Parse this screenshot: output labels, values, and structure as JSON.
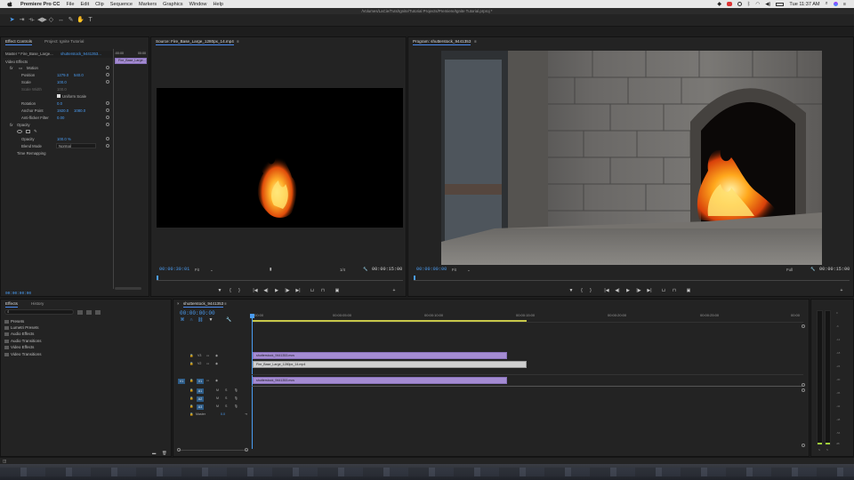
{
  "menubar": {
    "app_name": "Premiere Pro CC",
    "items": [
      "File",
      "Edit",
      "Clip",
      "Sequence",
      "Markers",
      "Graphics",
      "Window",
      "Help"
    ],
    "clock": "Tue 11:37 AM"
  },
  "title_path": "/Volumes/LaCie/Tuts/Ignite/Tutorial Projects/Premiere/Ignite Tutorial.prproj *",
  "effect_controls": {
    "tabs": [
      "Effect Controls",
      "Project: Ignite Tutorial"
    ],
    "master_label": "Master * Fire_Base_Large...",
    "clip_label": "shutterstock_9441353...",
    "mini_timeline_clip": "Fire_Base_Large...",
    "mini_ruler_start": ":00:00",
    "mini_ruler_end": "00:00",
    "section_video_effects": "Video Effects",
    "motion": "Motion",
    "position_label": "Position",
    "position_x": "1279.0",
    "position_y": "540.0",
    "scale_label": "Scale",
    "scale_value": "100.0",
    "scale_width_label": "Scale Width",
    "scale_width_value": "100.0",
    "uniform_scale": "Uniform Scale",
    "rotation_label": "Rotation",
    "rotation_value": "0.0",
    "anchor_label": "Anchor Point",
    "anchor_x": "1920.0",
    "anchor_y": "1080.0",
    "flicker_label": "Anti-flicker Filter",
    "flicker_value": "0.00",
    "opacity_section": "Opacity",
    "opacity_label": "Opacity",
    "opacity_value": "100.0 %",
    "blend_label": "Blend Mode",
    "blend_value": "Normal",
    "time_remap": "Time Remapping",
    "timecode": "00:00:00:00"
  },
  "source": {
    "title": "Source: Fire_Base_Large_1280px_14.mp4",
    "timecode": "00:00:30:01",
    "fit": "Fit",
    "quality": "1/4",
    "duration": "00:00:15:00"
  },
  "program": {
    "title": "Program: shutterstock_9441353",
    "timecode": "00:00:00:00",
    "fit": "Fit",
    "quality": "Full",
    "duration": "00:00:15:00"
  },
  "effects_panel": {
    "tabs": [
      "Effects",
      "History"
    ],
    "folders": [
      "Presets",
      "Lumetri Presets",
      "Audio Effects",
      "Audio Transitions",
      "Video Effects",
      "Video Transitions"
    ]
  },
  "timeline": {
    "sequence_tab": "shutterstock_9441353",
    "timecode": "00:00:00:00",
    "ruler": [
      ":00:00",
      "00:00:05:00",
      "00:00:10:00",
      "00:00:15:00",
      "00:00:20:00",
      "00:00:25:00",
      "00:00"
    ],
    "video_tracks": [
      "V3",
      "V2",
      "V1"
    ],
    "audio_tracks": [
      "A1",
      "A2",
      "A3"
    ],
    "source_v": "V1",
    "source_a": "A1",
    "master_label": "Master",
    "master_value": "0.0",
    "clips": {
      "v3": "shutterstock_9441353.mov",
      "v2": "Fire_Base_Large_1280px_14.mp4",
      "v1": "shutterstock_9441353.mov"
    }
  },
  "meters": {
    "ticks": [
      "0",
      "-6",
      "-12",
      "-18",
      "-24",
      "-30",
      "-36",
      "-42",
      "-48",
      "-54",
      "dB"
    ],
    "channels": [
      "S",
      "S"
    ]
  },
  "colors": {
    "accent_blue": "#4a9cf2",
    "clip_purple": "#a48bd2",
    "clip_white": "#d0d0d0"
  }
}
